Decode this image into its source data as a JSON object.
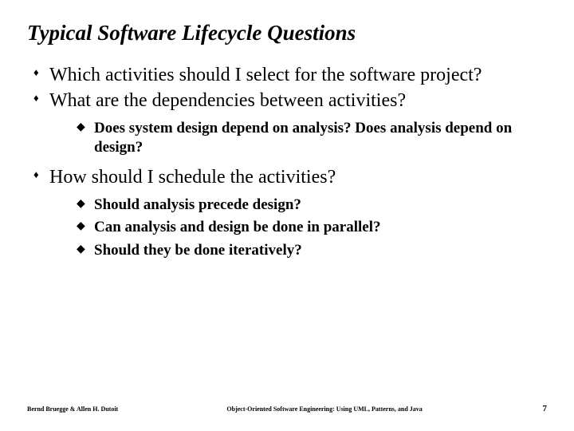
{
  "title": "Typical Software Lifecycle Questions",
  "bullets": {
    "b1": "Which activities should I select for the software project?",
    "b2": "What are the dependencies between activities?",
    "b2_sub": {
      "s1": "Does system design depend on analysis? Does analysis depend on design?"
    },
    "b3": "How should I schedule the activities?",
    "b3_sub": {
      "s1": "Should analysis precede design?",
      "s2": "Can analysis and design be done in parallel?",
      "s3": "Should they be done iteratively?"
    }
  },
  "footer": {
    "left": "Bernd Bruegge & Allen H. Dutoit",
    "center": "Object-Oriented Software Engineering: Using UML, Patterns, and Java",
    "page": "7"
  }
}
